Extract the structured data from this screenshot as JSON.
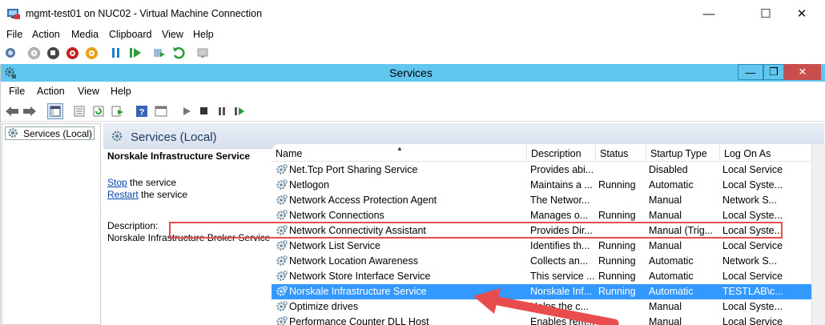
{
  "window": {
    "title": "mgmt-test01 on NUC02 - Virtual Machine Connection",
    "minimize": "—",
    "maximize": "☐",
    "close": "✕"
  },
  "vm_menu": [
    "File",
    "Action",
    "Media",
    "Clipboard",
    "View",
    "Help"
  ],
  "services_window": {
    "title": "Services"
  },
  "inner_menu": [
    "File",
    "Action",
    "View",
    "Help"
  ],
  "tree": {
    "root": "Services (Local)"
  },
  "pane": {
    "header": "Services (Local)",
    "selected_name": "Norskale Infrastructure Service",
    "stop_link": "Stop",
    "stop_rest": " the service",
    "restart_link": "Restart",
    "restart_rest": " the service",
    "desc_label": "Description:",
    "desc_text": "Norskale Infrastructure Broker Service"
  },
  "columns": [
    "Name",
    "Description",
    "Status",
    "Startup Type",
    "Log On As"
  ],
  "rows": [
    {
      "name": "Net.Tcp Port Sharing Service",
      "desc": "Provides abi...",
      "status": "",
      "startup": "Disabled",
      "logon": "Local Service"
    },
    {
      "name": "Netlogon",
      "desc": "Maintains a ...",
      "status": "Running",
      "startup": "Automatic",
      "logon": "Local Syste..."
    },
    {
      "name": "Network Access Protection Agent",
      "desc": "The Networ...",
      "status": "",
      "startup": "Manual",
      "logon": "Network S..."
    },
    {
      "name": "Network Connections",
      "desc": "Manages o...",
      "status": "Running",
      "startup": "Manual",
      "logon": "Local Syste..."
    },
    {
      "name": "Network Connectivity Assistant",
      "desc": "Provides Dir...",
      "status": "",
      "startup": "Manual (Trig...",
      "logon": "Local Syste..."
    },
    {
      "name": "Network List Service",
      "desc": "Identifies th...",
      "status": "Running",
      "startup": "Manual",
      "logon": "Local Service"
    },
    {
      "name": "Network Location Awareness",
      "desc": "Collects an...",
      "status": "Running",
      "startup": "Automatic",
      "logon": "Network S..."
    },
    {
      "name": "Network Store Interface Service",
      "desc": "This service ...",
      "status": "Running",
      "startup": "Automatic",
      "logon": "Local Service"
    },
    {
      "name": "Norskale Infrastructure Service",
      "desc": "Norskale Inf...",
      "status": "Running",
      "startup": "Automatic",
      "logon": "TESTLAB\\c...",
      "selected": true
    },
    {
      "name": "Optimize drives",
      "desc": "Helps the c...",
      "status": "",
      "startup": "Manual",
      "logon": "Local Syste..."
    },
    {
      "name": "Performance Counter DLL Host",
      "desc": "Enables rem...",
      "status": "",
      "startup": "Manual",
      "logon": "Local Service"
    }
  ],
  "colors": {
    "title_bar": "#62c7ee",
    "selection": "#3399ff",
    "highlight_box": "#e84c4c",
    "arrow": "#e84c4c"
  }
}
